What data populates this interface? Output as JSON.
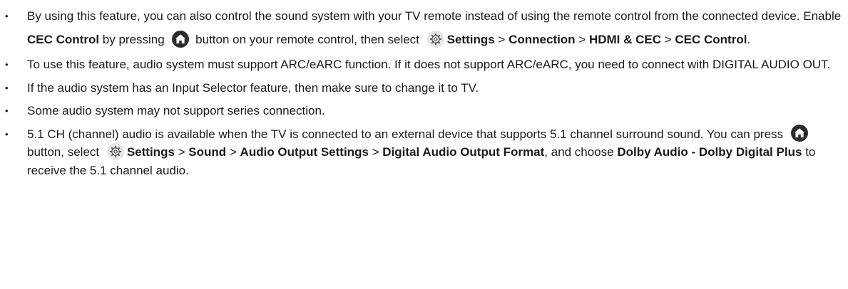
{
  "bullets": [
    {
      "parts": [
        {
          "t": "text",
          "v": "By using this feature, you can also control the sound system with your TV remote instead of using the remote control from the connected device. Enable "
        },
        {
          "t": "bold",
          "v": "CEC Control"
        },
        {
          "t": "text",
          "v": " by pressing "
        },
        {
          "t": "icon",
          "v": "home-icon"
        },
        {
          "t": "text",
          "v": " button on your remote control, then select "
        },
        {
          "t": "icon",
          "v": "settings-icon"
        },
        {
          "t": "bold",
          "v": "Settings"
        },
        {
          "t": "text",
          "v": " > "
        },
        {
          "t": "bold",
          "v": "Connection"
        },
        {
          "t": "text",
          "v": " > "
        },
        {
          "t": "bold",
          "v": "HDMI & CEC"
        },
        {
          "t": "text",
          "v": " > "
        },
        {
          "t": "bold",
          "v": "CEC Control"
        },
        {
          "t": "text",
          "v": "."
        }
      ]
    },
    {
      "parts": [
        {
          "t": "text",
          "v": "To use this feature, audio system must support ARC/eARC function. If it does not support ARC/eARC, you need to connect with DIGITAL AUDIO OUT."
        }
      ]
    },
    {
      "parts": [
        {
          "t": "text",
          "v": "If the audio system has an Input Selector feature, then make sure to change it to TV."
        }
      ]
    },
    {
      "parts": [
        {
          "t": "text",
          "v": "Some audio system may not support series connection."
        }
      ]
    },
    {
      "parts": [
        {
          "t": "text",
          "v": "5.1 CH (channel) audio is available when the TV is connected to an external device that supports 5.1 channel surround sound. You can press "
        },
        {
          "t": "icon",
          "v": "home-icon"
        },
        {
          "t": "text",
          "v": " button, select "
        },
        {
          "t": "icon",
          "v": "settings-icon"
        },
        {
          "t": "bold",
          "v": "Settings"
        },
        {
          "t": "text",
          "v": " > "
        },
        {
          "t": "bold",
          "v": "Sound"
        },
        {
          "t": "text",
          "v": " > "
        },
        {
          "t": "bold",
          "v": "Audio Output Settings"
        },
        {
          "t": "text",
          "v": " > "
        },
        {
          "t": "bold",
          "v": "Digital Audio Output Format"
        },
        {
          "t": "text",
          "v": ", and choose "
        },
        {
          "t": "bold",
          "v": "Dolby Audio - Dolby Digital Plus"
        },
        {
          "t": "text",
          "v": " to receive the 5.1 channel audio."
        }
      ]
    }
  ],
  "bullet_char": "•",
  "colors": {
    "text": "#1a1a1a",
    "home_icon_bg": "#2b2b2b",
    "settings_icon_bg": "#e6e6e6",
    "settings_icon_fg": "#555555"
  }
}
